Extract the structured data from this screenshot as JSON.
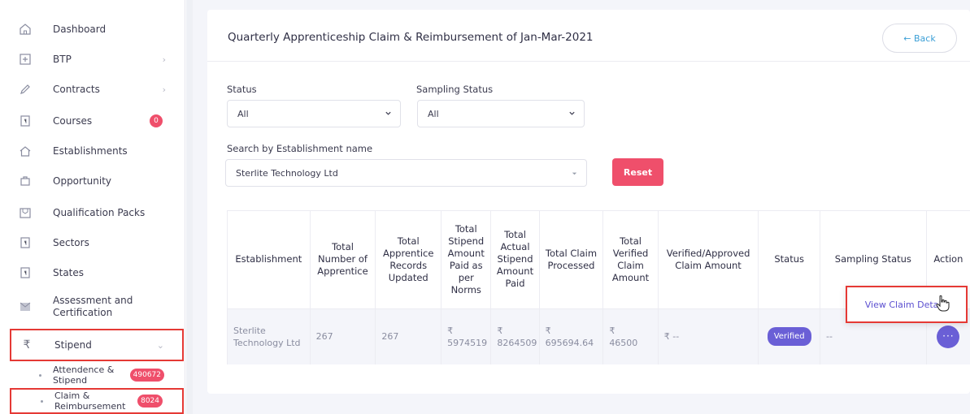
{
  "sidebar": {
    "items": [
      {
        "label": "Dashboard",
        "icon": "home-icon"
      },
      {
        "label": "BTP",
        "icon": "plus-box-icon",
        "chevron": "›"
      },
      {
        "label": "Contracts",
        "icon": "pen-icon",
        "chevron": "›"
      },
      {
        "label": "Courses",
        "icon": "document-icon",
        "badge": "0"
      },
      {
        "label": "Establishments",
        "icon": "home-outline-icon"
      },
      {
        "label": "Opportunity",
        "icon": "briefcase-icon"
      },
      {
        "label": "Qualification Packs",
        "icon": "package-icon"
      },
      {
        "label": "Sectors",
        "icon": "document-icon"
      },
      {
        "label": "States",
        "icon": "document-icon"
      },
      {
        "label": "Assessment and Certification",
        "icon": "certificate-icon"
      },
      {
        "label": "Stipend",
        "icon": "rupee-icon",
        "chevron": "⌄"
      }
    ],
    "subitems": [
      {
        "label": "Attendence & Stipend",
        "badge": "490672"
      },
      {
        "label": "Claim & Reimbursement",
        "badge": "8024"
      }
    ]
  },
  "header": {
    "title": "Quarterly Apprenticeship Claim & Reimbursement of Jan-Mar-2021",
    "back_label": "← Back"
  },
  "filters": {
    "status_label": "Status",
    "status_value": "All",
    "sampling_label": "Sampling Status",
    "sampling_value": "All",
    "search_label": "Search by Establishment name",
    "search_value": "Sterlite Technology Ltd",
    "reset_label": "Reset"
  },
  "table": {
    "headers": [
      "Establishment",
      "Total Number of Apprentice",
      "Total Apprentice Records Updated",
      "Total Stipend Amount Paid as per Norms",
      "Total Actual Stipend Amount Paid",
      "Total Claim Processed",
      "Total Verified Claim Amount",
      "Verified/Approved Claim Amount",
      "Status",
      "Sampling Status",
      "Action"
    ],
    "row": {
      "establishment": "Sterlite Technology Ltd",
      "total_apprentice": "267",
      "records_updated": "267",
      "stipend_norms_symbol": "₹",
      "stipend_norms": "5974519",
      "actual_stipend_symbol": "₹",
      "actual_stipend": "8264509",
      "claim_processed_symbol": "₹",
      "claim_processed": "695694.64",
      "verified_claim_symbol": "₹",
      "verified_claim": "46500",
      "approved_amount": "₹ --",
      "status": "Verified",
      "sampling_status": "--",
      "action_label": "···"
    }
  },
  "action_menu": {
    "item": "View Claim Details"
  },
  "colors": {
    "accent": "#6a5fd6",
    "danger": "#ef4f6b",
    "link": "#3b9fd6",
    "highlight": "#e53935"
  }
}
